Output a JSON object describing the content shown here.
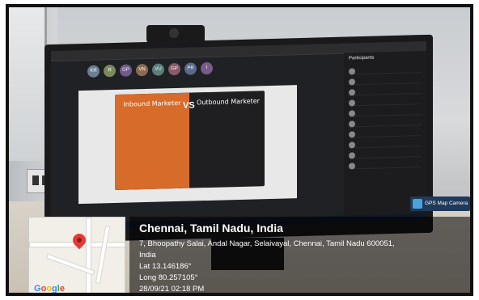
{
  "overlay": {
    "city": "Chennai, Tamil Nadu, India",
    "address_line1": "7, Bhoopathy Salai, Andal Nagar, Selaivayal, Chennai, Tamil Nadu 600051,",
    "address_line2": "India",
    "lat": "Lat 13.146186°",
    "long": "Long 80.257105°",
    "datetime": "28/09/21 02:18 PM"
  },
  "badge": {
    "label": "GPS Map Camera"
  },
  "map": {
    "logo": "Google",
    "pin_color": "#e53935"
  },
  "screen": {
    "panel_title": "Participants",
    "slide": {
      "left_title": "Inbound Marketer",
      "vs": "VS",
      "right_title": "Outbound Marketer"
    },
    "avatars": [
      "KR",
      "R",
      "GP",
      "VN",
      "VU",
      "GP",
      "PR",
      "I"
    ]
  }
}
